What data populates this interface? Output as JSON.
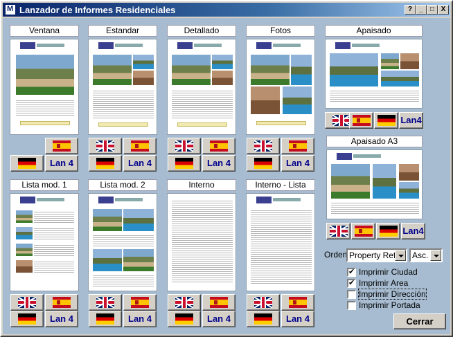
{
  "window": {
    "title": "Lanzador de Informes Residenciales",
    "controls": [
      "?",
      "_",
      "□",
      "X"
    ]
  },
  "reports": [
    {
      "label": "Ventana",
      "lan": "Lan 4"
    },
    {
      "label": "Estandar",
      "lan": "Lan 4"
    },
    {
      "label": "Detallado",
      "lan": "Lan 4"
    },
    {
      "label": "Fotos",
      "lan": "Lan 4"
    },
    {
      "label": "Apaisado",
      "lan": "Lan4"
    },
    {
      "label": "Apaisado A3",
      "lan": "Lan4"
    },
    {
      "label": "Lista mod. 1",
      "lan": "Lan 4"
    },
    {
      "label": "Lista mod. 2",
      "lan": "Lan 4"
    },
    {
      "label": "Interno",
      "lan": "Lan 4"
    },
    {
      "label": "Interno - Lista",
      "lan": "Lan 4"
    }
  ],
  "orden": {
    "label": "Orden:",
    "field": "Property Ref.",
    "direction": "Asc."
  },
  "options": [
    {
      "label": "Imprimir Ciudad",
      "checked": true
    },
    {
      "label": "Imprimir Area",
      "checked": true
    },
    {
      "label": "Imprimir Dirección",
      "checked": false
    },
    {
      "label": "Imprimir Portada",
      "checked": false
    }
  ],
  "close_label": "Cerrar",
  "icons": {
    "app": "app-icon",
    "es": "spain-flag-icon",
    "uk": "uk-flag-icon",
    "de": "germany-flag-icon"
  },
  "colors": {
    "title_bar": "#0a246a",
    "client_bg": "#a7bcd0",
    "lan_text": "#00008b"
  }
}
